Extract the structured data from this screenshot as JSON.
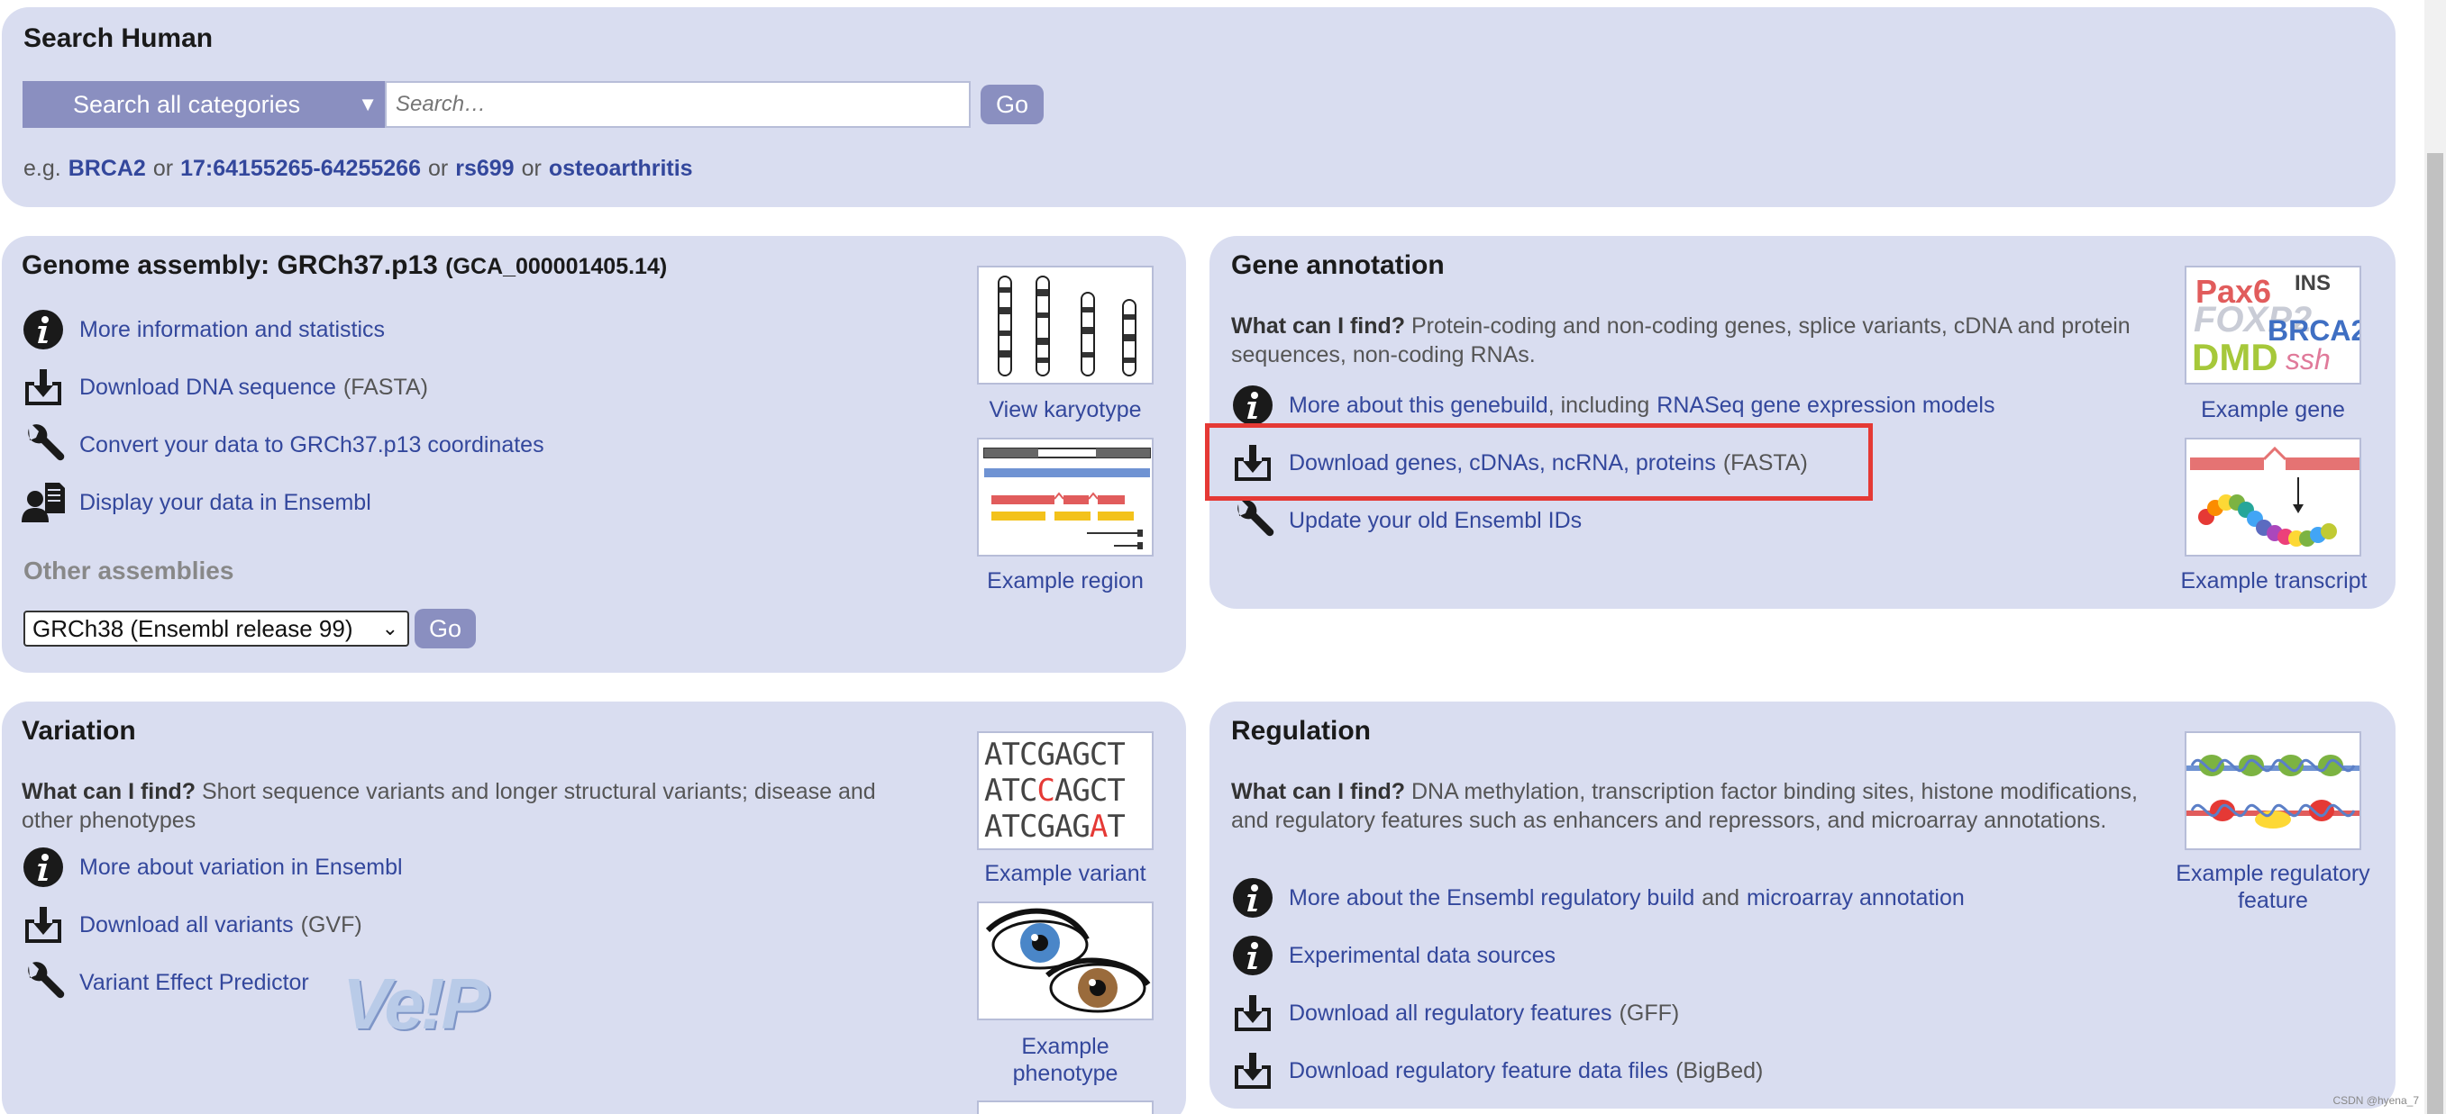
{
  "search": {
    "title": "Search Human",
    "category": "Search all categories",
    "placeholder": "Search…",
    "go": "Go",
    "eg_prefix": "e.g.",
    "examples": [
      "BRCA2",
      "17:64155265-64255266",
      "rs699",
      "osteoarthritis"
    ],
    "or": "or"
  },
  "genome": {
    "title": "Genome assembly: GRCh37.p13",
    "accession": "(GCA_000001405.14)",
    "links": [
      {
        "icon": "info-icon",
        "label": "More information and statistics",
        "suffix": ""
      },
      {
        "icon": "download-icon",
        "label": "Download DNA sequence",
        "suffix": "(FASTA)"
      },
      {
        "icon": "wrench-icon",
        "label": "Convert your data to GRCh37.p13 coordinates",
        "suffix": ""
      },
      {
        "icon": "user-data-icon",
        "label": "Display your data in Ensembl",
        "suffix": ""
      }
    ],
    "other_assemblies": "Other assemblies",
    "assembly_select": "GRCh38 (Ensembl release 99)",
    "go": "Go",
    "karyotype_caption": "View karyotype",
    "region_caption": "Example region"
  },
  "gene": {
    "title": "Gene annotation",
    "what_label": "What can I find?",
    "what_text": "Protein-coding and non-coding genes, splice variants, cDNA and protein sequences, non-coding RNAs.",
    "link1_a": "More about this genebuild",
    "link1_mid": ", including",
    "link1_b": "RNASeq gene expression models",
    "link2": "Download genes, cDNAs, ncRNA, proteins",
    "link2_suffix": "(FASTA)",
    "link3": "Update your old Ensembl IDs",
    "example_gene_caption": "Example gene",
    "example_transcript_caption": "Example transcript",
    "gene_words": [
      "Pax6",
      "INS",
      "FOXP2",
      "BRCA2",
      "DMD",
      "ssh"
    ]
  },
  "variation": {
    "title": "Variation",
    "what_label": "What can I find?",
    "what_text": "Short sequence variants and longer structural variants; disease and other phenotypes",
    "link1": "More about variation in Ensembl",
    "link2": "Download all variants",
    "link2_suffix": "(GVF)",
    "link3": "Variant Effect Predictor",
    "vep_logo": "Ve!P",
    "seq_lines": [
      "ATCGAGCT",
      "ATCCAGCT",
      "ATCGAGAT"
    ],
    "example_variant_caption": "Example variant",
    "example_phenotype_caption": "Example phenotype"
  },
  "regulation": {
    "title": "Regulation",
    "what_label": "What can I find?",
    "what_text": "DNA methylation, transcription factor binding sites, histone modifications, and regulatory features such as enhancers and repressors, and microarray annotations.",
    "link1_a": "More about the Ensembl regulatory build",
    "link1_mid": "and",
    "link1_b": "microarray annotation",
    "link2": "Experimental data sources",
    "link3": "Download all regulatory features",
    "link3_suffix": "(GFF)",
    "link4": "Download regulatory feature data files",
    "link4_suffix": "(BigBed)",
    "example_caption": "Example regulatory feature"
  },
  "watermark": "CSDN @hyena_7",
  "colors": {
    "panel": "#d9ddf0",
    "link": "#33479c",
    "button": "#8a8fc0",
    "highlight": "#e53935"
  }
}
